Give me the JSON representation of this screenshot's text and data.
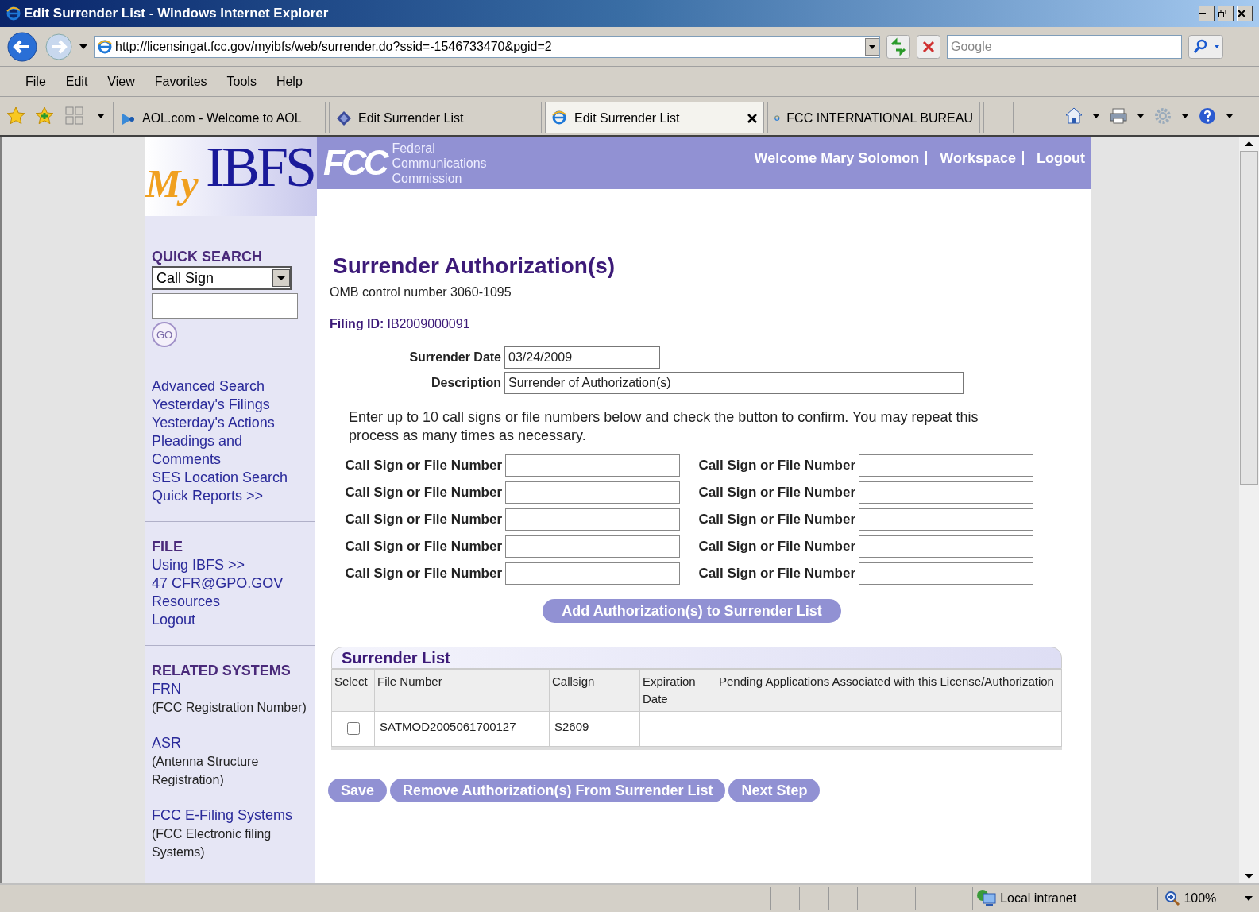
{
  "window": {
    "title": "Edit Surrender List - Windows Internet Explorer"
  },
  "address_bar": {
    "url": "http://licensingat.fcc.gov/myibfs/web/surrender.do?ssid=-1546733470&pgid=2"
  },
  "search_box": {
    "placeholder": "Google"
  },
  "menu": [
    "File",
    "Edit",
    "View",
    "Favorites",
    "Tools",
    "Help"
  ],
  "tabs": [
    {
      "label": "AOL.com - Welcome to AOL",
      "selected": false,
      "kind": "aol"
    },
    {
      "label": "Edit Surrender List",
      "selected": false,
      "kind": "site"
    },
    {
      "label": "Edit Surrender List",
      "selected": true,
      "kind": "ie"
    },
    {
      "label": "FCC INTERNATIONAL BUREAU",
      "selected": false,
      "kind": "ie"
    }
  ],
  "header": {
    "logo_my": "My",
    "logo_ibfs": "IBFS",
    "fcc_mark": "FCC",
    "agency": [
      "Federal",
      "Communications",
      "Commission"
    ],
    "links": [
      "Welcome Mary Solomon",
      "Workspace",
      "Logout"
    ]
  },
  "sidebar": {
    "quick_search": {
      "title": "QUICK SEARCH",
      "select": "Call Sign",
      "go": "GO"
    },
    "search_links": [
      "Advanced Search",
      "Yesterday's Filings",
      "Yesterday's Actions",
      "Pleadings and Comments",
      "SES Location Search",
      "Quick Reports >>"
    ],
    "file": {
      "title": "FILE",
      "links": [
        "Using IBFS >>",
        "47 CFR@GPO.GOV",
        "Resources",
        "Logout"
      ]
    },
    "related": {
      "title": "RELATED SYSTEMS",
      "items": [
        {
          "link": "FRN",
          "note": "(FCC Registration Number)"
        },
        {
          "link": "ASR",
          "note": "(Antenna Structure Registration)"
        },
        {
          "link": "FCC E-Filing Systems",
          "note": "(FCC Electronic filing Systems)"
        }
      ]
    }
  },
  "main": {
    "title": "Surrender Authorization(s)",
    "omb": "OMB control number 3060-1095",
    "filing_id_label": "Filing ID:",
    "filing_id": "IB2009000091",
    "fields": [
      {
        "label": "Surrender Date",
        "value": "03/24/2009"
      },
      {
        "label": "Description",
        "value": "Surrender of Authorization(s)"
      }
    ],
    "instructions": "Enter up to 10 call signs or file numbers below and check the button to confirm. You may repeat this process as many times as necessary.",
    "entry_label": [
      "Call Sign or File Number",
      "Call Sign or File Number",
      "Call Sign or File Number",
      "Call Sign or File Number",
      "Call Sign or File Number",
      "Call Sign or File Number",
      "Call Sign or File Number",
      "Call Sign or File Number",
      "Call Sign or File Number",
      "Call Sign or File Number"
    ],
    "add_button": "Add Authorization(s) to Surrender List",
    "surrender_list": {
      "title": "Surrender List",
      "columns": [
        "Select",
        "File Number",
        "Callsign",
        "Expiration Date",
        "Pending Applications Associated with this License/Authorization"
      ],
      "rows": [
        {
          "checked": false,
          "file_number": "SATMOD2005061700127",
          "callsign": "S2609"
        }
      ]
    },
    "buttons": [
      "Save",
      "Remove Authorization(s) From Surrender List",
      "Next Step"
    ]
  },
  "status_bar": {
    "zone": "Local intranet",
    "zoom": "100%"
  }
}
